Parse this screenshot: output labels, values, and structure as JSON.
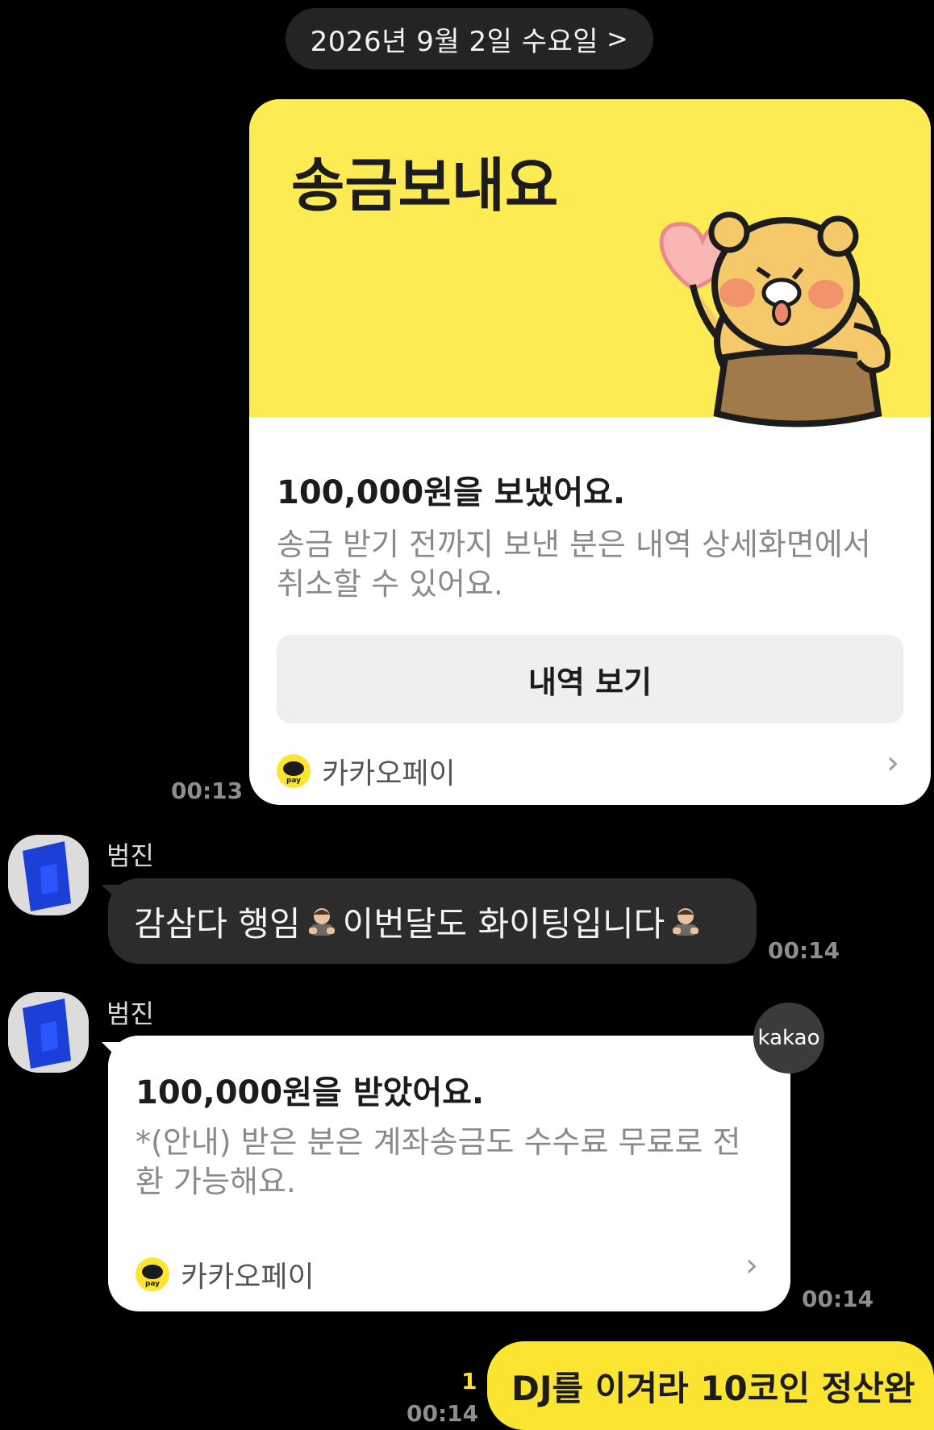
{
  "date_header": {
    "label": "2026년 9월 2일 수요일",
    "chevron": ">"
  },
  "send_card": {
    "title": "송금보내요",
    "amount_text": "100,000원을 보냈어요.",
    "description": "송금 받기 전까지 보낸 분은 내역 상세화면에서 취소할 수 있어요.",
    "button_label": "내역 보기",
    "provider": "카카오페이",
    "pay_logo_text": "pay",
    "time": "00:13",
    "illustration": "heart-bear-sticker"
  },
  "messages": [
    {
      "sender": "범진",
      "text_before": "감삼다 행임",
      "text_after": " 이번달도 화이팅입니다",
      "emoji": "bowing-person",
      "time": "00:14"
    }
  ],
  "receive_card": {
    "sender": "범진",
    "amount_text": "100,000원을 받았어요.",
    "description": "*(안내) 받은 분은 계좌송금도 수수료 무료로 전환 가능해요.",
    "provider": "카카오페이",
    "pay_logo_text": "pay",
    "badge": "kakao",
    "time": "00:14"
  },
  "my_message": {
    "text": "DJ를 이겨라 10코인 정산완",
    "unread_count": "1",
    "time": "00:14"
  },
  "colors": {
    "background": "#000000",
    "kakao_yellow": "#fce530",
    "card_yellow": "#fceb52",
    "dark_bubble": "#2c2c2c"
  }
}
